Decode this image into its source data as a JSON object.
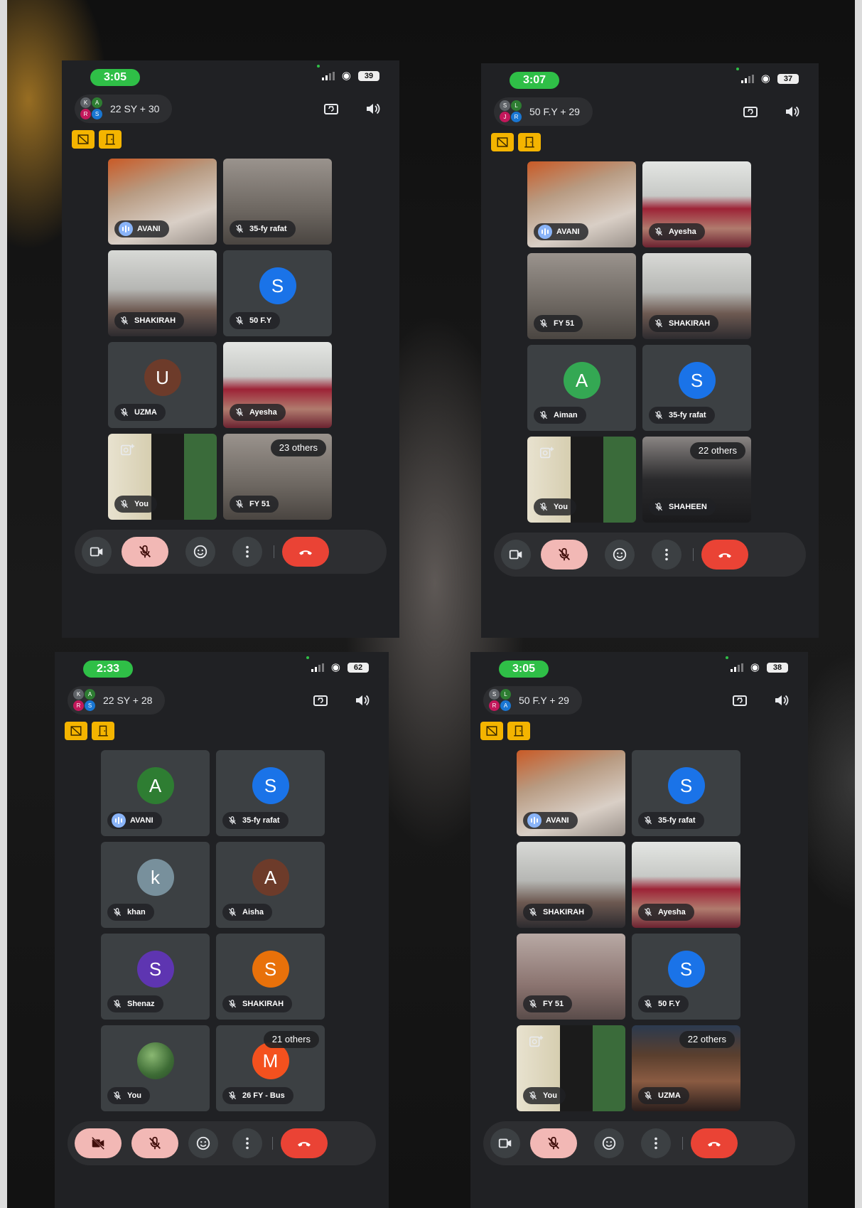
{
  "phones": [
    {
      "time": "3:05",
      "battery": "39",
      "meeting_title": "22 SY + 30",
      "avatar_letters": [
        "K",
        "A",
        "R",
        "S"
      ],
      "tiles": [
        {
          "name": "AVANI",
          "style": "v-warm",
          "speaking": true
        },
        {
          "name": "35-fy rafat",
          "style": "v-grey"
        },
        {
          "name": "SHAKIRAH",
          "style": "v-room"
        },
        {
          "name": "50 F.Y",
          "letter": "S",
          "color": "#1a73e8"
        },
        {
          "name": "UZMA",
          "letter": "U",
          "color": "#6d3b2a"
        },
        {
          "name": "Ayesha",
          "style": "v-hijab"
        },
        {
          "name": "You",
          "style": "v-self",
          "self": true
        },
        {
          "name": "FY 51",
          "style": "v-grey",
          "others": "23 others"
        }
      ]
    },
    {
      "time": "3:07",
      "battery": "37",
      "meeting_title": "50 F.Y + 29",
      "avatar_letters": [
        "S",
        "L",
        "J",
        "R"
      ],
      "tiles": [
        {
          "name": "AVANI",
          "style": "v-warm",
          "speaking": true
        },
        {
          "name": "Ayesha",
          "style": "v-hijab"
        },
        {
          "name": "FY 51",
          "style": "v-grey"
        },
        {
          "name": "SHAKIRAH",
          "style": "v-room"
        },
        {
          "name": "Aiman",
          "letter": "A",
          "color": "#34a853"
        },
        {
          "name": "35-fy rafat",
          "letter": "S",
          "color": "#1a73e8"
        },
        {
          "name": "You",
          "style": "v-self",
          "self": true
        },
        {
          "name": "SHAHEEN",
          "style": "v-mask",
          "others": "22 others"
        }
      ]
    },
    {
      "time": "2:33",
      "battery": "62",
      "meeting_title": "22 SY + 28",
      "avatar_letters": [
        "K",
        "A",
        "R",
        "S"
      ],
      "tiles": [
        {
          "name": "AVANI",
          "letter": "A",
          "color": "#2e7d32",
          "speaking": true
        },
        {
          "name": "35-fy rafat",
          "letter": "S",
          "color": "#1a73e8"
        },
        {
          "name": "khan",
          "letter": "k",
          "color": "#78909c"
        },
        {
          "name": "Aisha",
          "letter": "A",
          "color": "#6d3b2a"
        },
        {
          "name": "Shenaz",
          "letter": "S",
          "color": "#5e35b1"
        },
        {
          "name": "SHAKIRAH",
          "letter": "S",
          "color": "#e8710a"
        },
        {
          "name": "You",
          "tree": true
        },
        {
          "name": "26 FY - Bus",
          "letter": "M",
          "color": "#f4511e",
          "others": "21 others"
        }
      ]
    },
    {
      "time": "3:05",
      "battery": "38",
      "meeting_title": "50 F.Y + 29",
      "avatar_letters": [
        "S",
        "L",
        "R",
        "A"
      ],
      "tiles": [
        {
          "name": "AVANI",
          "style": "v-warm",
          "speaking": true
        },
        {
          "name": "35-fy rafat",
          "letter": "S",
          "color": "#1a73e8"
        },
        {
          "name": "SHAKIRAH",
          "style": "v-room"
        },
        {
          "name": "Ayesha",
          "style": "v-hijab"
        },
        {
          "name": "FY 51",
          "style": "v-dim"
        },
        {
          "name": "50 F.Y",
          "letter": "S",
          "color": "#1a73e8"
        },
        {
          "name": "You",
          "style": "v-self",
          "self": true
        },
        {
          "name": "UZMA",
          "style": "v-girl",
          "others": "22 others"
        }
      ]
    }
  ],
  "controls": [
    {
      "camera": "on"
    },
    {
      "camera": "on"
    },
    {
      "camera": "off"
    },
    {
      "camera": "on"
    }
  ],
  "icons": [
    "camera-switch-icon",
    "speaker-icon",
    "no-sign-icon",
    "door-icon",
    "video-camera-icon",
    "mic-off-icon",
    "emoji-icon",
    "more-vert-icon",
    "end-call-icon",
    "add-camera-icon",
    "audio-bars-icon"
  ],
  "colors": {
    "accent_green": "#2fbf47",
    "tool_yellow": "#f4b400",
    "end_call_red": "#ea4335",
    "mic_off_pink": "#f2b8b5",
    "speaking_blue": "#8ab4f8"
  }
}
